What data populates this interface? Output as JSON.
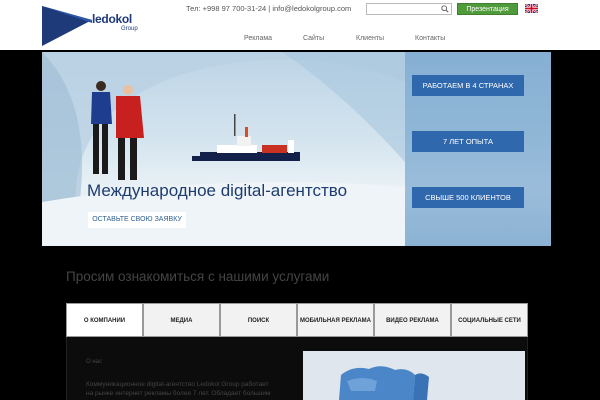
{
  "header": {
    "logo": {
      "name": "ledokol",
      "sub": "Group"
    },
    "contact": "Тел: +998 97 700-31-24 | info@ledokolgroup.com",
    "search": {
      "placeholder": ""
    },
    "present_label": "Презентация",
    "nav": [
      "Реклама",
      "Сайты",
      "Клиенты",
      "Контакты"
    ]
  },
  "hero": {
    "title": "Международное digital-агентство",
    "cta_label": "ОСТАВЬТЕ СВОЮ ЗАЯВКУ",
    "stats": [
      "РАБОТАЕМ В 4 СТРАНАХ",
      "7 ЛЕТ ОПЫТА",
      "СВЫШЕ 500 КЛИЕНТОВ"
    ]
  },
  "services": {
    "title": "Просим ознакомиться с нашими услугами",
    "tabs": [
      "О КОМПАНИИ",
      "МЕДИА",
      "ПОИСК",
      "МОБИЛЬНАЯ РЕКЛАМА",
      "ВИДЕО РЕКЛАМА",
      "СОЦИАЛЬНЫЕ СЕТИ"
    ],
    "active_tab": 0,
    "about_heading": "О нас",
    "about_text": "Коммуникационное digital-агентство Ledokol Group работает на рынке интернет рекламы более 7 лет. Обладает большим опытом"
  },
  "colors": {
    "accent": "#2f68ad",
    "presentation": "#4f9a3b",
    "brand": "#1e3a78"
  }
}
